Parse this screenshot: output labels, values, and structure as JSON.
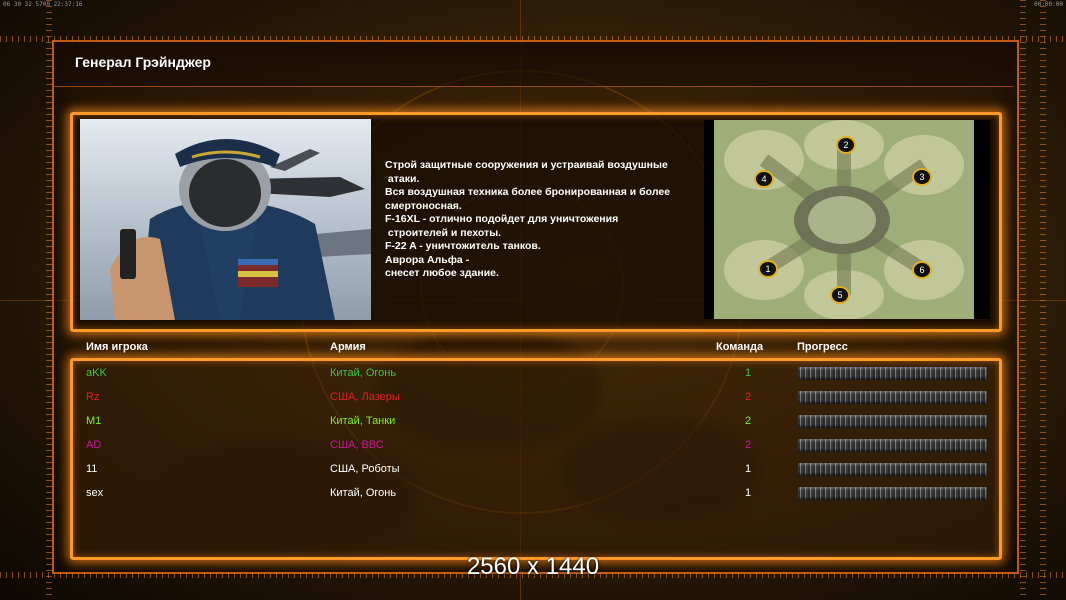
{
  "topbar": {
    "left": "06 30 32 5700  22:37:16",
    "right": "00:00:00"
  },
  "title": "Генерал Грэйнджер",
  "description": [
    "Строй защитные сооружения и устраивай воздушные",
    " атаки.",
    "Вся воздушная техника более бронированная и более",
    "смертоносная.",
    "F-16XL - отлично подойдет для уничтожения",
    " строителей и пехоты.",
    "F-22 A - уничтожитель танков.",
    "Аврора Альфа -",
    "снесет любое здание."
  ],
  "map": {
    "slots": [
      "1",
      "2",
      "3",
      "4",
      "5",
      "6"
    ]
  },
  "table": {
    "headers": {
      "name": "Имя игрока",
      "army": "Армия",
      "team": "Команда",
      "progress": "Прогресс"
    },
    "rows": [
      {
        "name": "aKK",
        "army": "Китай, Огонь",
        "team": "1",
        "color": "#3cc83c",
        "progress": 1
      },
      {
        "name": "Rz",
        "army": "США, Лазеры",
        "team": "2",
        "color": "#e02020",
        "progress": 1
      },
      {
        "name": "M1",
        "army": "Китай, Танки",
        "team": "2",
        "color": "#7cf21e",
        "progress": 1
      },
      {
        "name": "AD",
        "army": "США, ВВС",
        "team": "2",
        "color": "#c8189a",
        "progress": 1
      },
      {
        "name": "11",
        "army": "США, Роботы",
        "team": "1",
        "color": "#ffffff",
        "progress": 1
      },
      {
        "name": "sex",
        "army": "Китай, Огонь",
        "team": "1",
        "color": "#ffffff",
        "progress": 1
      }
    ]
  },
  "resolution": "2560 x 1440"
}
